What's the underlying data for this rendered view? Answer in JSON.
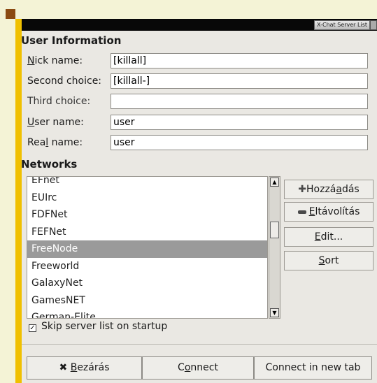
{
  "window": {
    "title": "X-Chat Server List"
  },
  "user_info": {
    "heading": "User Information",
    "fields": [
      {
        "label": "Nick name:",
        "value": "[killall]"
      },
      {
        "label": "Second choice:",
        "value": "[killall-]"
      },
      {
        "label": "Third choice:",
        "value": ""
      },
      {
        "label": "User name:",
        "value": "user"
      },
      {
        "label": "Real name:",
        "value": "user"
      }
    ]
  },
  "networks": {
    "heading": "Networks",
    "items": [
      "EFnet",
      "EUIrc",
      "FDFNet",
      "FEFNet",
      "FreeNode",
      "Freeworld",
      "GalaxyNet",
      "GamesNET",
      "German-Elite"
    ],
    "selected": "FreeNode",
    "buttons": {
      "add": "Hozzáadás",
      "remove": "Eltávolítás",
      "edit": "Edit...",
      "sort": "Sort"
    }
  },
  "skip_startup": {
    "label": "Skip server list on startup",
    "checked": true
  },
  "footer": {
    "close": "Bezárás",
    "connect": "Connect",
    "connect_new_tab": "Connect in new tab"
  }
}
